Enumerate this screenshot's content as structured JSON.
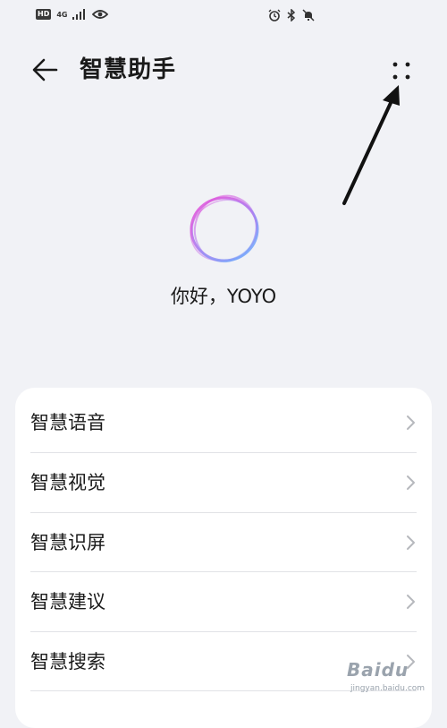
{
  "status_bar": {
    "hd": "HD",
    "network": "4G",
    "icons": [
      "hd-badge",
      "signal-icon",
      "eye-icon",
      "alarm-icon",
      "bluetooth-icon",
      "mute-icon"
    ]
  },
  "header": {
    "title": "智慧助手",
    "back_icon": "arrow-left-icon",
    "more_icon": "more-dots-icon"
  },
  "hero": {
    "greeting": "你好，YOYO"
  },
  "menu": {
    "items": [
      {
        "label": "智慧语音"
      },
      {
        "label": "智慧视觉"
      },
      {
        "label": "智慧识屏"
      },
      {
        "label": "智慧建议"
      },
      {
        "label": "智慧搜索"
      }
    ]
  },
  "watermark": {
    "text": "Baidu",
    "sub": "jingyan.baidu.com"
  },
  "colors": {
    "background": "#f1f2f6",
    "card": "#ffffff",
    "orb_pink": "#ef4fd6",
    "orb_blue": "#5fb8ff"
  }
}
